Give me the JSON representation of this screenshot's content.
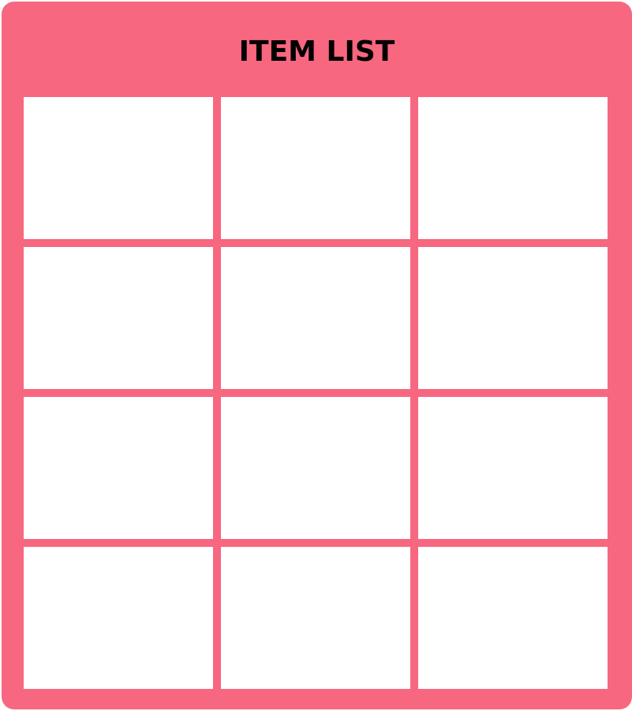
{
  "window": {
    "title": "ITEM LIST"
  },
  "theme": {
    "panel_color": "#f7677f",
    "slot_color": "#ffffff",
    "title_color": "#000000"
  },
  "grid": {
    "columns": 3,
    "rows": 4,
    "slots": [
      {
        "content": ""
      },
      {
        "content": ""
      },
      {
        "content": ""
      },
      {
        "content": ""
      },
      {
        "content": ""
      },
      {
        "content": ""
      },
      {
        "content": ""
      },
      {
        "content": ""
      },
      {
        "content": ""
      },
      {
        "content": ""
      },
      {
        "content": ""
      },
      {
        "content": ""
      }
    ]
  }
}
